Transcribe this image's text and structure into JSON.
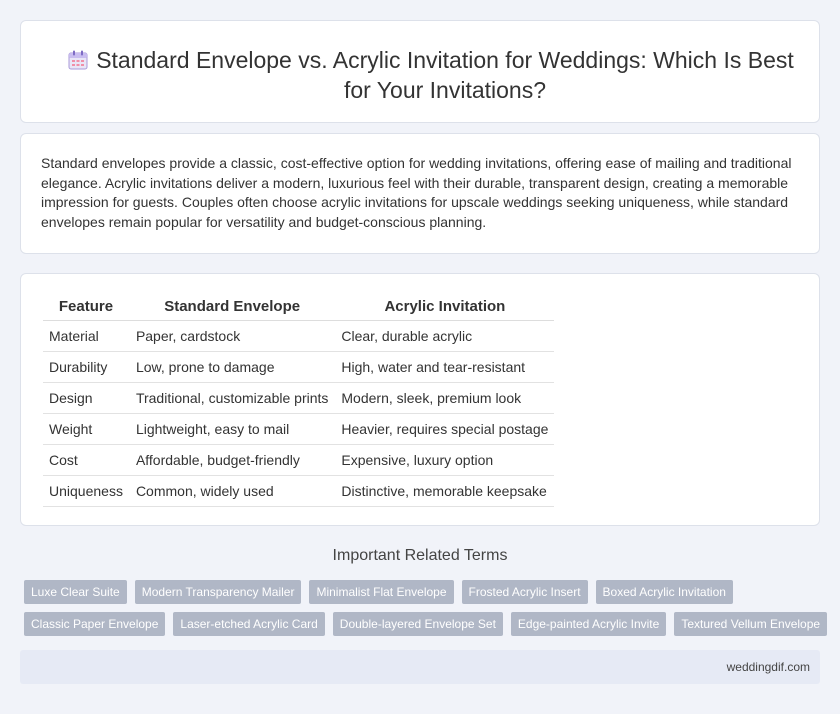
{
  "header": {
    "title": "Standard Envelope vs. Acrylic Invitation for Weddings: Which Is Best for Your Invitations?",
    "icon": "calendar-icon"
  },
  "summary": {
    "text": "Standard envelopes provide a classic, cost-effective option for wedding invitations, offering ease of mailing and traditional elegance. Acrylic invitations deliver a modern, luxurious feel with their durable, transparent design, creating a memorable impression for guests. Couples often choose acrylic invitations for upscale weddings seeking uniqueness, while standard envelopes remain popular for versatility and budget-conscious planning."
  },
  "table": {
    "headers": [
      "Feature",
      "Standard Envelope",
      "Acrylic Invitation"
    ],
    "rows": [
      [
        "Material",
        "Paper, cardstock",
        "Clear, durable acrylic"
      ],
      [
        "Durability",
        "Low, prone to damage",
        "High, water and tear-resistant"
      ],
      [
        "Design",
        "Traditional, customizable prints",
        "Modern, sleek, premium look"
      ],
      [
        "Weight",
        "Lightweight, easy to mail",
        "Heavier, requires special postage"
      ],
      [
        "Cost",
        "Affordable, budget-friendly",
        "Expensive, luxury option"
      ],
      [
        "Uniqueness",
        "Common, widely used",
        "Distinctive, memorable keepsake"
      ]
    ]
  },
  "related": {
    "title": "Important Related Terms",
    "row1": [
      "Luxe Clear Suite",
      "Modern Transparency Mailer",
      "Minimalist Flat Envelope",
      "Frosted Acrylic Insert",
      "Boxed Acrylic Invitation"
    ],
    "row2": [
      "Classic Paper Envelope",
      "Laser-etched Acrylic Card",
      "Double-layered Envelope Set",
      "Edge-painted Acrylic Invite",
      "Textured Vellum Envelope"
    ]
  },
  "footer": {
    "site": "weddingdif.com"
  }
}
